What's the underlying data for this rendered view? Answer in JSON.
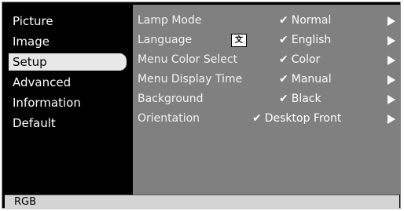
{
  "sidebar": {
    "items": [
      {
        "label": "Picture",
        "selected": false
      },
      {
        "label": "Image",
        "selected": false
      },
      {
        "label": "Setup",
        "selected": true
      },
      {
        "label": "Advanced",
        "selected": false
      },
      {
        "label": "Information",
        "selected": false
      },
      {
        "label": "Default",
        "selected": false
      }
    ]
  },
  "settings": {
    "rows": [
      {
        "label": "Lamp Mode",
        "value": "Normal"
      },
      {
        "label": "Language",
        "value": "English",
        "icon": "language-icon"
      },
      {
        "label": "Menu Color Select",
        "value": "Color"
      },
      {
        "label": "Menu Display Time",
        "value": "Manual"
      },
      {
        "label": "Background",
        "value": "Black"
      },
      {
        "label": "Orientation",
        "value": "Desktop Front"
      }
    ],
    "check_glyph": "✔",
    "language_icon_glyph": "文"
  },
  "status_bar": {
    "source": "RGB"
  },
  "colors": {
    "sidebar_bg": "#000000",
    "content_bg": "#808080",
    "selected_bg": "#e8e8e8",
    "status_bg": "#d4d4d4"
  }
}
